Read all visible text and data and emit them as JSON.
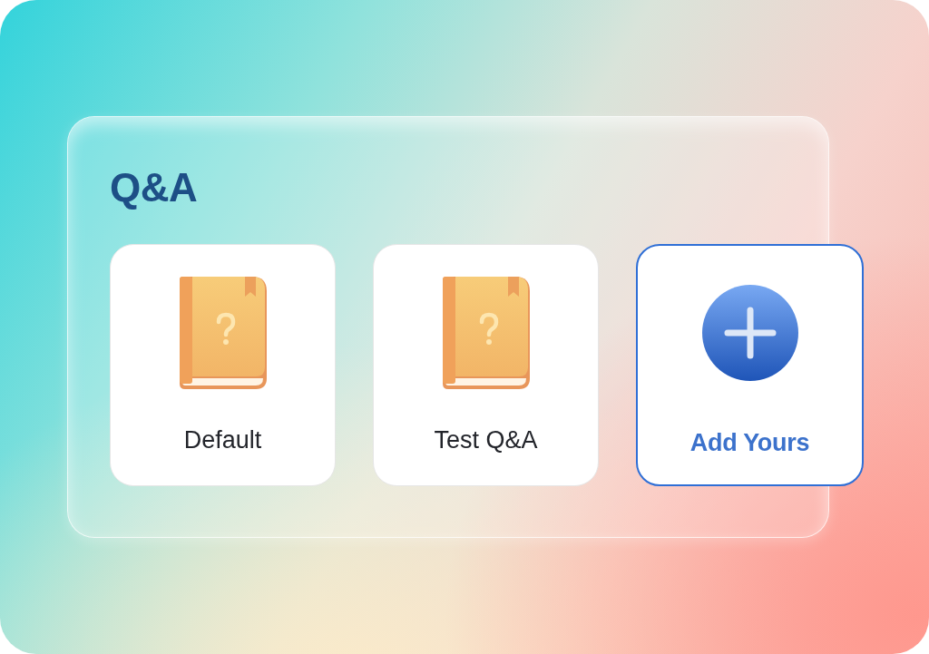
{
  "panel": {
    "title": "Q&A",
    "cards": [
      {
        "kind": "book",
        "label": "Default"
      },
      {
        "kind": "book",
        "label": "Test Q&A"
      },
      {
        "kind": "add",
        "label": "Add Yours"
      }
    ]
  }
}
